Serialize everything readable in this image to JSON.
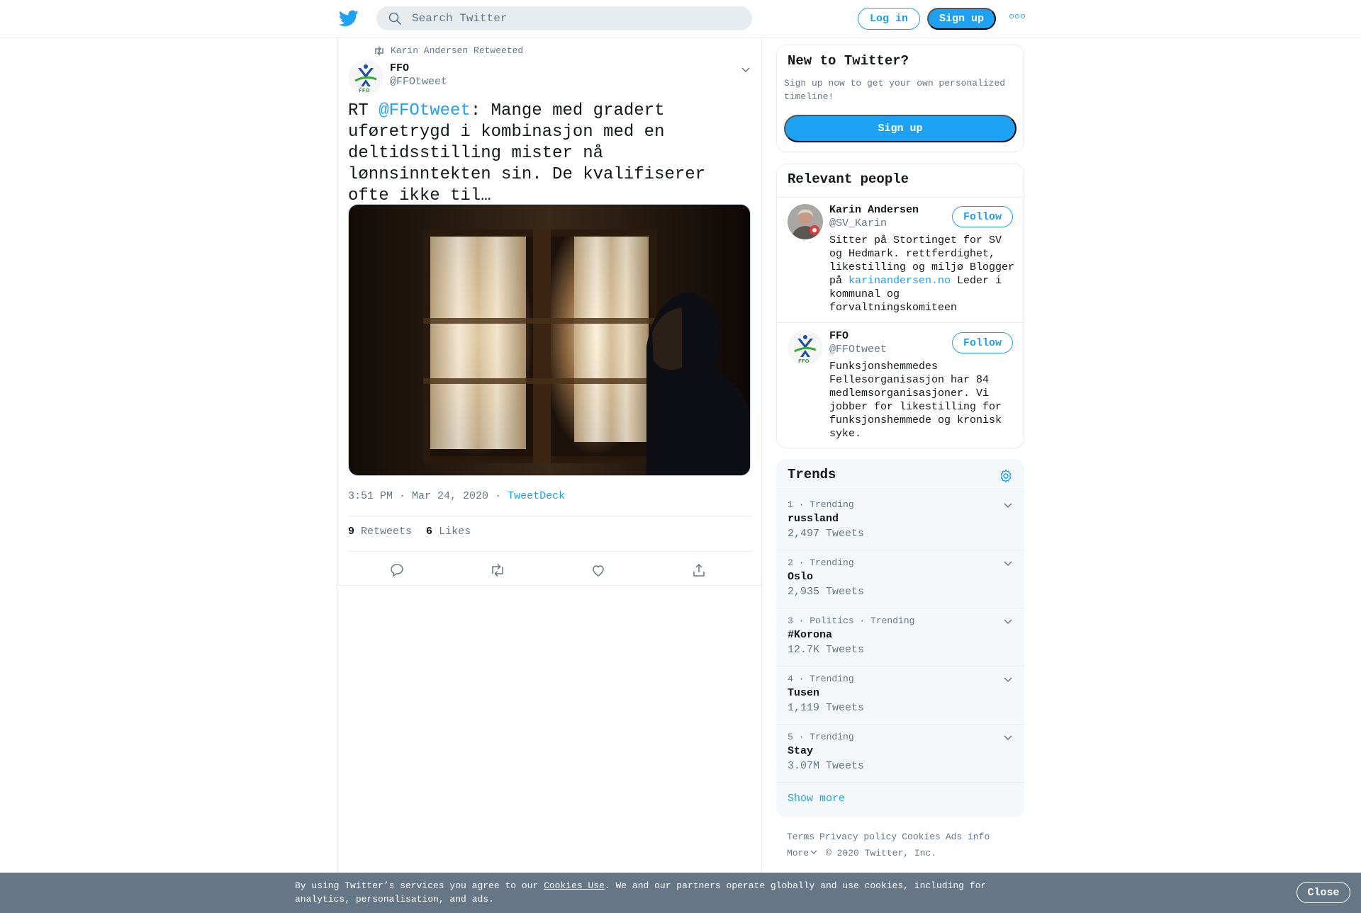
{
  "header": {
    "logo_icon": "twitter-bird-icon",
    "search_placeholder": "Search Twitter",
    "login_label": "Log in",
    "signup_label": "Sign up",
    "more_icon": "more-dots-icon"
  },
  "tweet": {
    "retweet_context": "Karin Andersen Retweeted",
    "author_name": "FFO",
    "author_handle": "@FFOtweet",
    "text_prefix": "RT ",
    "mention": "@FFOtweet",
    "text_body": ": Mange med gradert uføretrygd i kombinasjon med en deltidsstilling mister nå lønnsinntekten sin. De kvalifiserer ofte ikke til…",
    "timestamp": "3:51 PM · Mar 24, 2020",
    "separator": "·",
    "source": "TweetDeck",
    "retweets_count": "9",
    "retweets_label": "Retweets",
    "likes_count": "6",
    "likes_label": "Likes",
    "actions": [
      "reply-icon",
      "retweet-icon",
      "like-icon",
      "share-icon"
    ]
  },
  "sidebar": {
    "new_to_twitter": {
      "title": "New to Twitter?",
      "description": "Sign up now to get your own personalized timeline!",
      "signup_label": "Sign up"
    },
    "relevant_people": {
      "title": "Relevant people",
      "people": [
        {
          "name": "Karin Andersen",
          "handle": "@SV_Karin",
          "follow_label": "Follow",
          "bio_1": "Sitter på Stortinget for SV og Hedmark. rettferdighet, likestilling og miljø Blogger på ",
          "bio_link": "karinandersen.no",
          "bio_2": " Leder i kommunal og forvaltningskomiteen"
        },
        {
          "name": "FFO",
          "handle": "@FFOtweet",
          "follow_label": "Follow",
          "bio_1": "Funksjonshemmedes Fellesorganisasjon har 84 medlemsorganisasjoner. Vi jobber for likestilling for funksjonshemmede og kronisk syke."
        }
      ]
    },
    "trends": {
      "title": "Trends",
      "items": [
        {
          "context": "1 · Trending",
          "name": "russland",
          "count": "2,497 Tweets"
        },
        {
          "context": "2 · Trending",
          "name": "Oslo",
          "count": "2,935 Tweets"
        },
        {
          "context": "3 · Politics · Trending",
          "name": "#Korona",
          "count": "12.7K Tweets"
        },
        {
          "context": "4 · Trending",
          "name": "Tusen",
          "count": "1,119 Tweets"
        },
        {
          "context": "5 · Trending",
          "name": "Stay",
          "count": "3.07M Tweets"
        }
      ],
      "show_more": "Show more"
    },
    "footer": {
      "links": [
        "Terms",
        "Privacy policy",
        "Cookies",
        "Ads info"
      ],
      "more": "More",
      "copyright": "© 2020 Twitter, Inc."
    }
  },
  "cookie_bar": {
    "text_1": "By using Twitter’s services you agree to our ",
    "link": "Cookies Use",
    "text_2": ". We and our partners operate globally and use cookies, including for analytics, personalisation, and ads.",
    "close_label": "Close"
  },
  "colors": {
    "accent": "#1da1f2",
    "secondary_text": "#657786",
    "border": "#e6ecf0",
    "cookie_bg": "#657786"
  }
}
